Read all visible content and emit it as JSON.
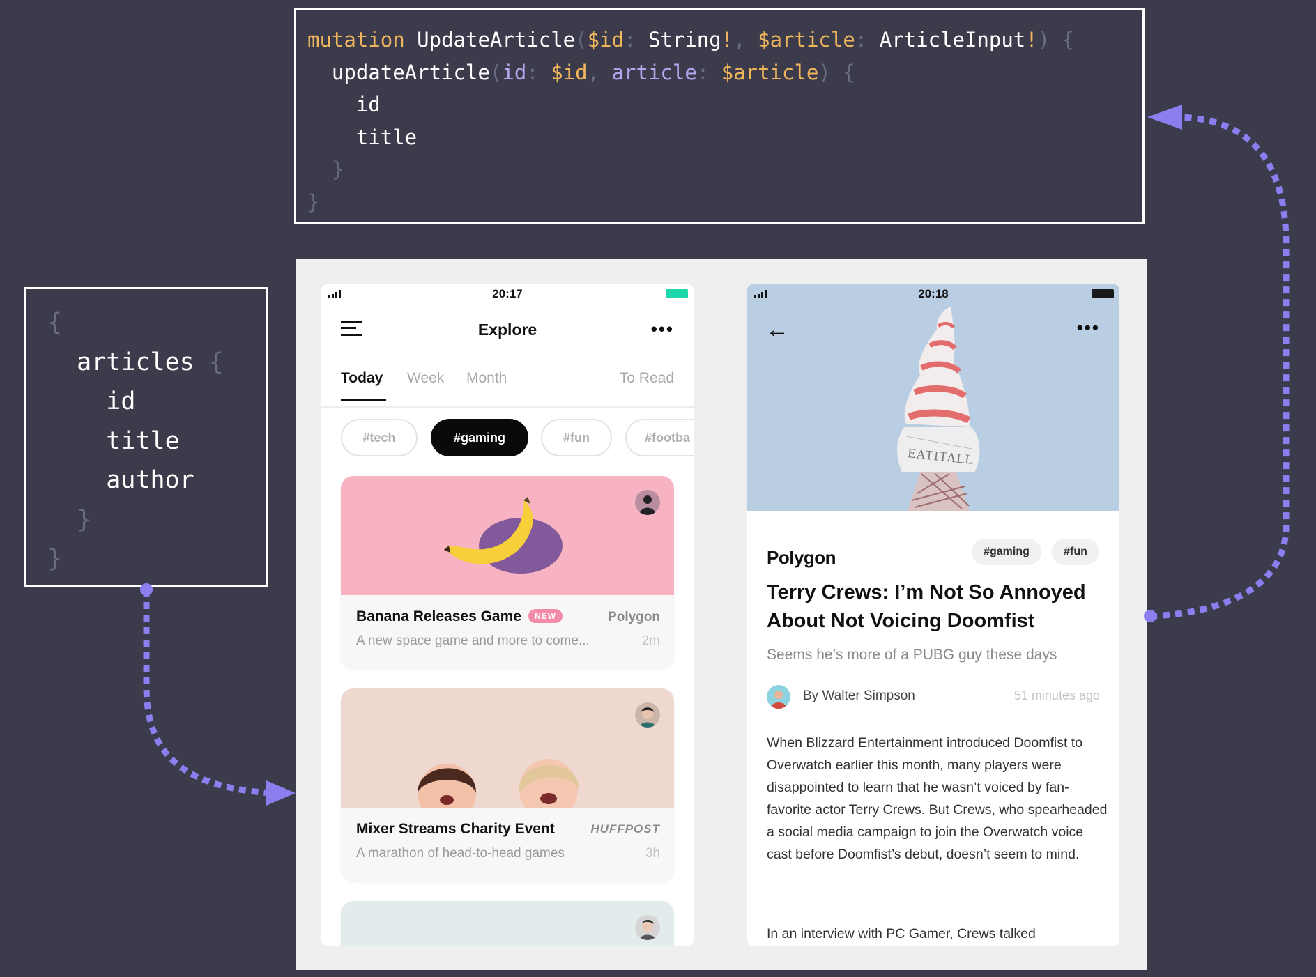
{
  "mutation_code": {
    "line1": {
      "keyword": "mutation",
      "name": "UpdateArticle",
      "open_paren": "(",
      "var_id": "$id",
      "colon1": ":",
      "type_string": "String",
      "bang1": "!",
      "comma": ",",
      "var_article": "$article",
      "colon2": ":",
      "type_input": "ArticleInput",
      "bang2": "!",
      "close_paren": ")",
      "brace": "{"
    },
    "line2": {
      "field": "updateArticle",
      "open_paren": "(",
      "arg_id": "id",
      "colon1": ":",
      "val_id": "$id",
      "comma": ",",
      "arg_article": "article",
      "colon2": ":",
      "val_article": "$article",
      "close_paren": ")",
      "brace": "{"
    },
    "line3": "id",
    "line4": "title",
    "line5": "}",
    "line6": "}"
  },
  "query_code": {
    "open": "{",
    "field": "articles",
    "field_brace": "{",
    "sub1": "id",
    "sub2": "title",
    "sub3": "author",
    "close_inner": "}",
    "close_outer": "}"
  },
  "colors": {
    "background": "#3b3b4b",
    "keyword": "#f0b65c",
    "argument": "#b6a4ee",
    "arrow": "#8b7ff0",
    "battery_left": "#1dd6a9",
    "card1_image": "#f7b3c2",
    "card2_image": "#efd8cf",
    "card3_image": "#e3ecec",
    "hero_sky": "#b9cde3"
  },
  "left_phone": {
    "time": "20:17",
    "title": "Explore",
    "menu_icon": "hamburger-icon",
    "more_icon": "more-dots-icon",
    "tabs": [
      "Today",
      "Week",
      "Month",
      "To Read"
    ],
    "active_tab": "Today",
    "chips": [
      "#tech",
      "#gaming",
      "#fun",
      "#footba"
    ],
    "active_chip": "#gaming",
    "cards": [
      {
        "title": "Banana Releases Game",
        "badge": "NEW",
        "source": "Polygon",
        "description": "A new space game and more to come...",
        "time": "2m"
      },
      {
        "title": "Mixer Streams Charity Event",
        "source": "HUFFPOST",
        "description": "A marathon of head-to-head games",
        "time": "3h"
      }
    ]
  },
  "right_phone": {
    "time": "20:18",
    "back_icon": "back-arrow-icon",
    "outlet": "Polygon",
    "tags": [
      "#gaming",
      "#fun"
    ],
    "headline": "Terry Crews: I’m Not So Annoyed About Not Voicing Doomfist",
    "subhead": "Seems he’s more of a PUBG guy these days",
    "author": "By Walter Simpson",
    "time_ago": "51 minutes ago",
    "sign_text": "EATITALL",
    "body_paragraph_1": "When Blizzard Entertainment introduced Doomfist to Overwatch earlier this month, many players were disappointed to learn that he wasn’t voiced by fan-favorite actor Terry Crews. But Crews, who spearheaded a social media campaign to join the Overwatch voice cast before Doomfist’s debut, doesn’t seem to mind.",
    "body_paragraph_2": "In an interview with PC Gamer, Crews talked"
  }
}
